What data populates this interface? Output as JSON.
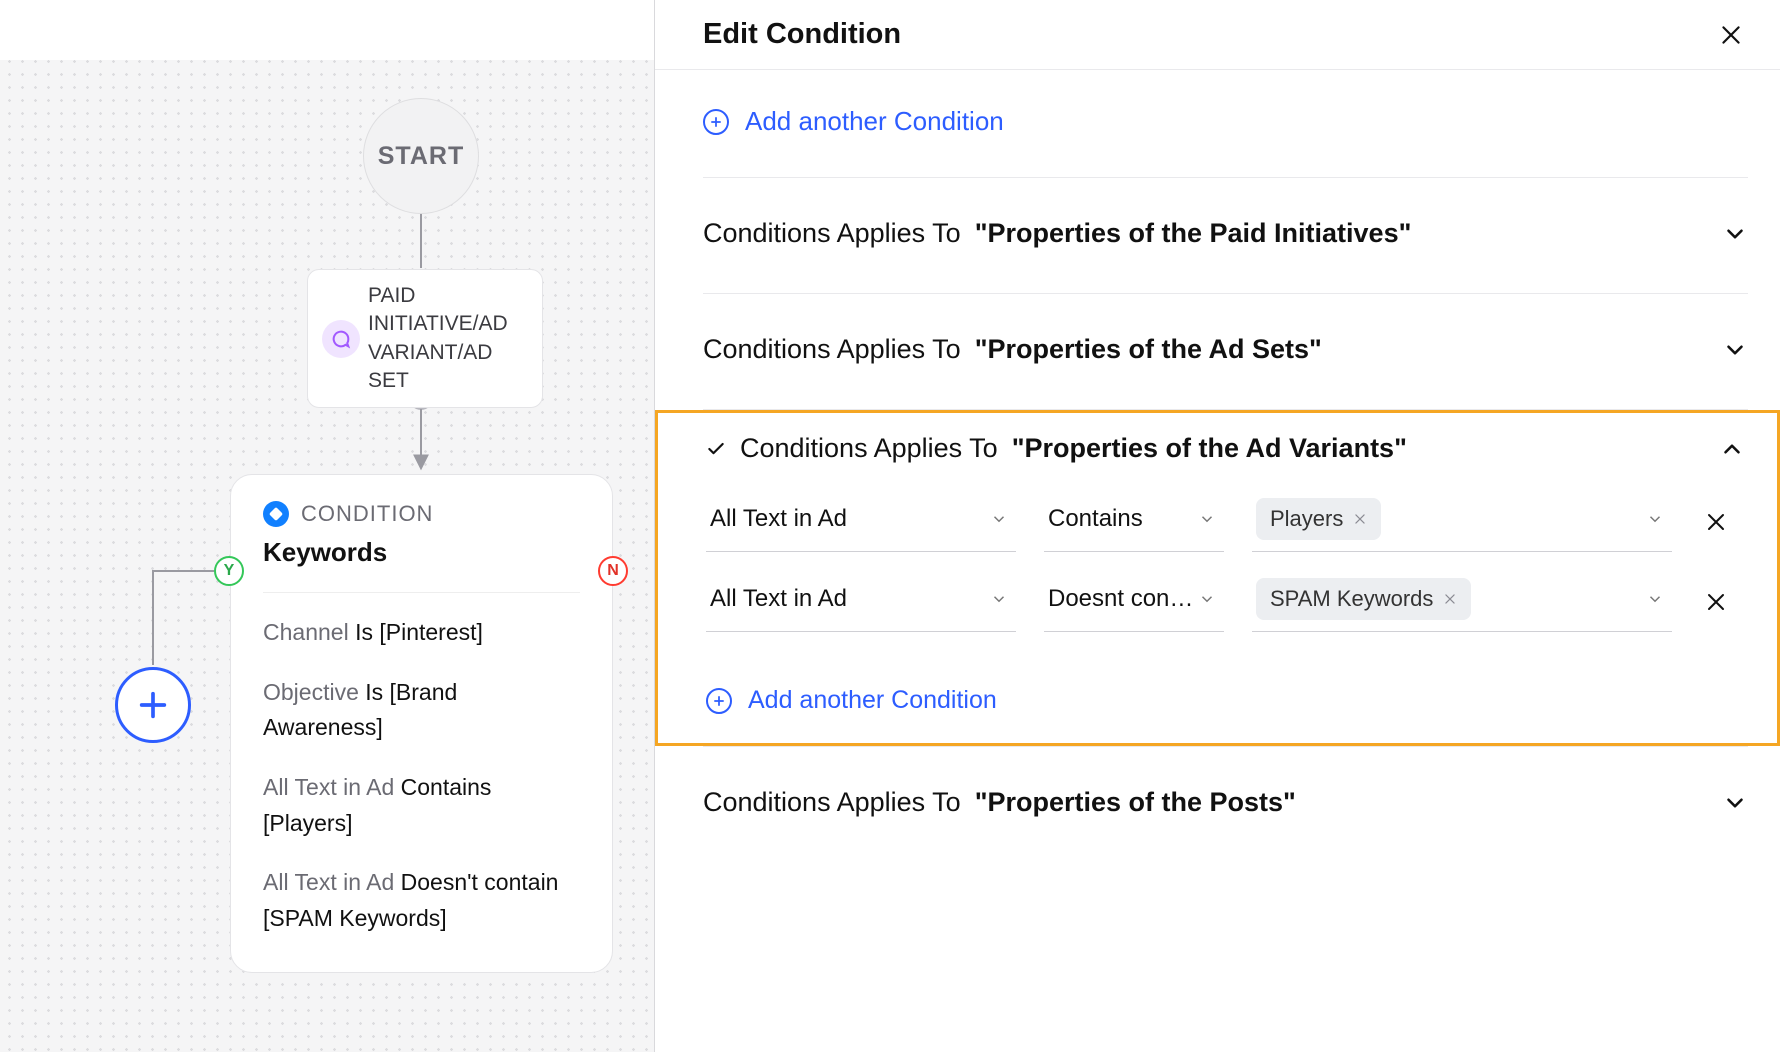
{
  "colors": {
    "accent_blue": "#2d5dff",
    "ok_green": "#34c759",
    "danger_red": "#ff3b30",
    "highlight_orange": "#f5a623",
    "trigger_purple": "#a259ff"
  },
  "canvas": {
    "start_label": "START",
    "trigger_icon": "chat-bubble-icon",
    "trigger_text": "PAID INITIATIVE/AD VARIANT/AD SET",
    "yes_badge": "Y",
    "no_badge": "N"
  },
  "condition_card": {
    "eyebrow": "CONDITION",
    "title": "Keywords",
    "lines": [
      {
        "left": "Channel",
        "right": "Is [Pinterest]"
      },
      {
        "left": "Objective",
        "right": "Is [Brand Awareness]"
      },
      {
        "left": "All Text in Ad",
        "right": "Contains [Players]"
      },
      {
        "left": "All Text in Ad",
        "right": "Doesn't contain [SPAM Keywords]"
      }
    ]
  },
  "panel": {
    "title": "Edit Condition",
    "add_another_label": "Add another Condition",
    "section_prefix": "Conditions Applies To",
    "sections": [
      {
        "expanded": false,
        "target": "\"Properties of the Paid Initiatives\""
      },
      {
        "expanded": false,
        "target": "\"Properties of the Ad Sets\""
      },
      {
        "expanded": true,
        "target": "\"Properties of the Ad Variants\"",
        "rows": [
          {
            "field": "All Text in Ad",
            "operator": "Contains",
            "value": "Players"
          },
          {
            "field": "All Text in Ad",
            "operator": "Doesnt con…",
            "value": "SPAM Keywords"
          }
        ],
        "add_label": "Add another Condition"
      },
      {
        "expanded": false,
        "target": "\"Properties of the Posts\""
      }
    ]
  }
}
